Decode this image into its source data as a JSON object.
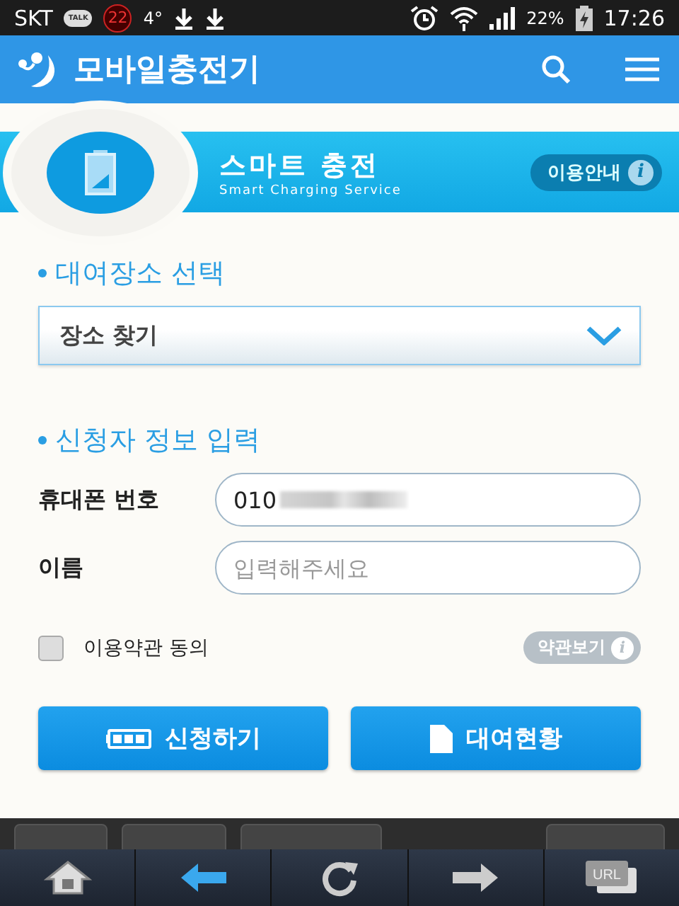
{
  "status_bar": {
    "carrier": "SKT",
    "talk": "TALK",
    "badge": "22",
    "temperature": "4°",
    "battery": "22%",
    "time": "17:26"
  },
  "app_bar": {
    "title": "모바일충전기"
  },
  "banner": {
    "title": "스마트 충전",
    "subtitle": "Smart  Charging Service",
    "guide_button": "이용안내",
    "info_icon": "i"
  },
  "location": {
    "heading": "대여장소 선택",
    "select_value": "장소 찾기"
  },
  "applicant": {
    "heading": "신청자 정보 입력",
    "fields": [
      {
        "label": "휴대폰 번호",
        "value": "010",
        "masked": true
      },
      {
        "label": "이름",
        "placeholder": "입력해주세요",
        "masked": false
      }
    ]
  },
  "terms": {
    "label": "이용약관 동의",
    "checked": false,
    "view_button": "약관보기",
    "info_icon": "i"
  },
  "actions": [
    {
      "label": "신청하기",
      "kind": "battery"
    },
    {
      "label": "대여현황",
      "kind": "document"
    }
  ],
  "toolbar": [
    {
      "kind": "home"
    },
    {
      "kind": "back"
    },
    {
      "kind": "reload"
    },
    {
      "kind": "forward"
    },
    {
      "kind": "url",
      "label": "URL"
    }
  ]
}
